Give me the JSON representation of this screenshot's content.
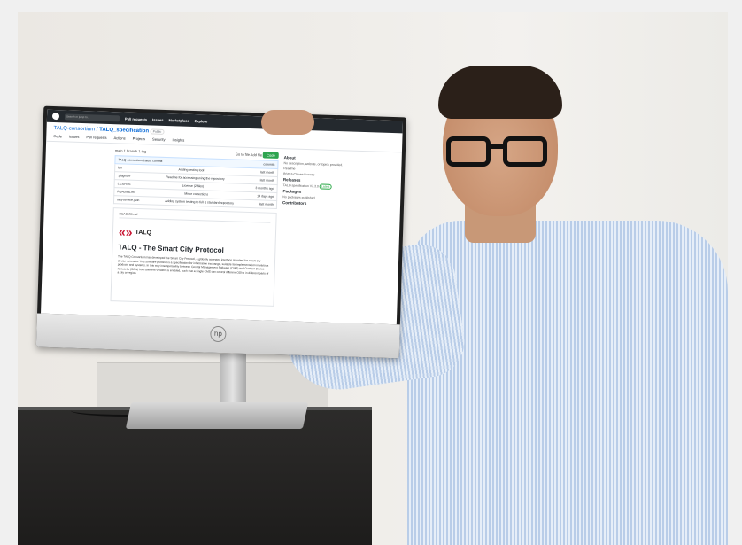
{
  "screen": {
    "topbar": {
      "search": "Search or jump to...",
      "nav": [
        "Pull requests",
        "Issues",
        "Marketplace",
        "Explore"
      ]
    },
    "repo": {
      "owner": "TALQ-consortium",
      "name": "TALQ_specification",
      "visibility": "Public"
    },
    "tabs": [
      "Code",
      "Issues",
      "Pull requests",
      "Actions",
      "Projects",
      "Security",
      "Insights"
    ],
    "files_bar": {
      "branch": "main",
      "branches": "1 branch",
      "tags": "1 tag",
      "goto": "Go to file",
      "add": "Add file",
      "code": "Code"
    },
    "commit": {
      "author": "TALQ-consortium",
      "message": "Latest commit",
      "history": "commits"
    },
    "files": [
      {
        "name": "bin",
        "msg": "Adding testing tool",
        "when": "last month"
      },
      {
        "name": ".gitignore",
        "msg": "Readme for accessing using the repository",
        "when": "last month"
      },
      {
        "name": "LICENSE",
        "msg": "License (2 files)",
        "when": "3 months ago"
      },
      {
        "name": "README.md",
        "msg": "Minor corrections",
        "when": "14 days ago"
      },
      {
        "name": "talq-service.json",
        "msg": "Adding system testing to full & standard repository",
        "when": "last month"
      }
    ],
    "readme": {
      "file": "README.md",
      "logo": "TALQ",
      "title": "TALQ - The Smart City Protocol",
      "text": "The TALQ Consortium has developed the Smart City Protocol, a globally accepted interface standard for smart city device networks. This software protocol is a specification for information exchange, suitable for implementation in various products and systems. In this way interoperability between Central Management Software (CMS) and Outdoor Device Networks (ODN) from different vendors is enabled, such that a single CMS can control different ODNs in different parts of a city or region."
    },
    "sidebar": {
      "about_title": "About",
      "about_text": "No description, website, or topics provided.",
      "readme": "Readme",
      "license": "BSD-3-Clause License",
      "releases_title": "Releases",
      "release": "TALQ specification V2.3.0",
      "release_badge": "Latest",
      "packages_title": "Packages",
      "packages_text": "No packages published",
      "contributors_title": "Contributors"
    }
  },
  "bezel_logo": "hp"
}
